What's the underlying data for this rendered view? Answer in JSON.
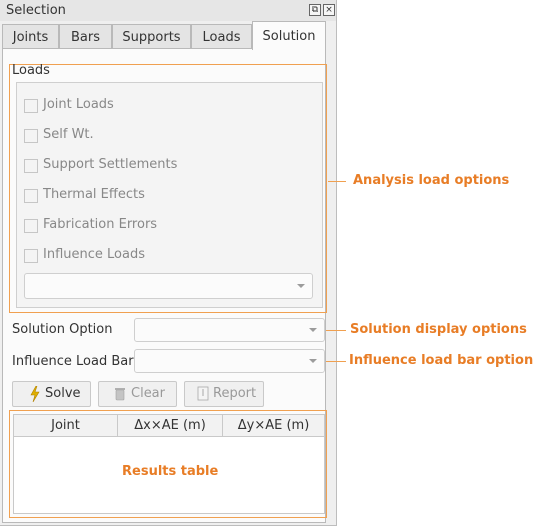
{
  "panel": {
    "title": "Selection",
    "title_buttons": [
      "⧉",
      "×"
    ],
    "tabs": [
      "Joints",
      "Bars",
      "Supports",
      "Loads",
      "Solution"
    ],
    "active_tab": "Solution"
  },
  "loads_group": {
    "label": "Loads",
    "options": [
      {
        "label": "Joint Loads",
        "checked": false,
        "enabled": false
      },
      {
        "label": "Self Wt.",
        "checked": false,
        "enabled": false
      },
      {
        "label": "Support Settlements",
        "checked": false,
        "enabled": false
      },
      {
        "label": "Thermal Effects",
        "checked": false,
        "enabled": false
      },
      {
        "label": "Fabrication Errors",
        "checked": false,
        "enabled": false
      },
      {
        "label": "Influence Loads",
        "checked": false,
        "enabled": false
      }
    ],
    "influence_select_value": ""
  },
  "solution_option": {
    "label": "Solution Option",
    "value": ""
  },
  "influence_load_bar": {
    "label": "Influence Load Bar",
    "value": ""
  },
  "buttons": {
    "solve": "Solve",
    "clear": "Clear",
    "report": "Report"
  },
  "results_table": {
    "columns": [
      "Joint",
      "Δx×AE (m)",
      "Δy×AE (m)"
    ],
    "rows": []
  },
  "annotations": {
    "analysis": "Analysis load options",
    "display": "Solution display options",
    "influence": "Influence load bar option",
    "results": "Results table"
  },
  "colors": {
    "annotation": "#e87d26",
    "callout_border": "#f0a050",
    "solve_icon": "#e0b000"
  }
}
